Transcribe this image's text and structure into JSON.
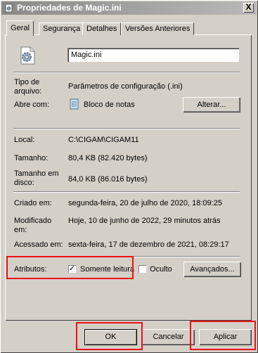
{
  "window": {
    "title": "Propriedades de Magic.ini",
    "close_symbol": "X"
  },
  "tabs": [
    {
      "label": "Geral",
      "active": true
    },
    {
      "label": "Segurança",
      "active": false
    },
    {
      "label": "Detalhes",
      "active": false
    },
    {
      "label": "Versões Anteriores",
      "active": false
    }
  ],
  "file": {
    "name": "Magic.ini",
    "icon": "ini-settings-file-icon"
  },
  "properties": {
    "type_label": "Tipo de arquivo:",
    "type_value": "Parâmetros de configuração (.ini)",
    "opens_with_label": "Abre com:",
    "opens_with_value": "Bloco de notas",
    "opens_with_icon": "notepad-icon",
    "change_button": "Alterar...",
    "location_label": "Local:",
    "location_value": "C:\\CIGAM\\CIGAM11",
    "size_label": "Tamanho:",
    "size_value": "80,4 KB (82.420 bytes)",
    "disk_size_label": "Tamanho em disco:",
    "disk_size_value": "84,0 KB (86.016 bytes)",
    "created_label": "Criado em:",
    "created_value": "segunda-feira, 20 de julho de 2020, 18:09:25",
    "modified_label": "Modificado em:",
    "modified_value": "Hoje, 10 de junho de 2022, 29 minutos atrás",
    "accessed_label": "Acessado em:",
    "accessed_value": "sexta-feira, 17 de dezembro de 2021, 08:29:17"
  },
  "attributes": {
    "label": "Atributos:",
    "readonly_label": "Somente leitura",
    "readonly_checked": true,
    "hidden_label": "Oculto",
    "hidden_checked": false,
    "advanced_button": "Avançados..."
  },
  "footer": {
    "ok": "OK",
    "cancel": "Cancelar",
    "apply": "Aplicar"
  },
  "colors": {
    "highlight": "#e11111",
    "face": "#d4d0c8"
  }
}
